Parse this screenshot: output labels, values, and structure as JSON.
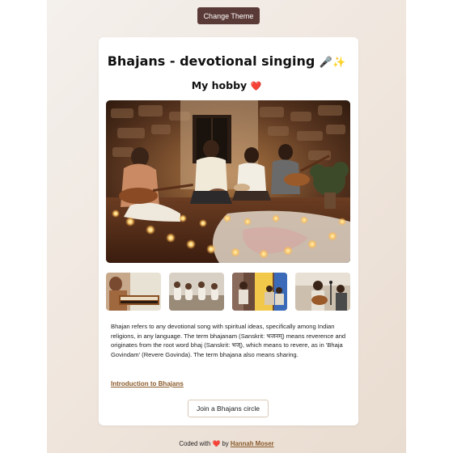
{
  "toolbar": {
    "theme_button_label": "Change Theme"
  },
  "header": {
    "title": "Bhajans - devotional singing",
    "title_icons": "🎤✨",
    "subtitle": "My hobby",
    "subtitle_icon": "❤️"
  },
  "gallery": {
    "hero_alt": "Group singing bhajans in candlelit room",
    "thumbnails": [
      {
        "alt": "Harmonium player"
      },
      {
        "alt": "Group sitting in circle"
      },
      {
        "alt": "Singers with colorful light"
      },
      {
        "alt": "Guitar and microphone singer"
      }
    ]
  },
  "content": {
    "paragraph": "Bhajan refers to any devotional song with spiritual ideas, specifically among Indian religions, in any language. The term bhajanam (Sanskrit: भजनम्) means reverence and originates from the root word bhaj (Sanskrit: भज्), which means to revere, as in 'Bhaja Govindam' (Revere Govinda). The term bhajana also means sharing.",
    "intro_link": "Introduction to Bhajans",
    "join_button": "Join a Bhajans circle"
  },
  "footer": {
    "prefix": "Coded with",
    "heart": "❤️",
    "by": "by",
    "author": "Hannah Moser"
  },
  "colors": {
    "theme_button_bg": "#5a3a36",
    "link": "#8a5a2a",
    "heart": "#e0244a"
  }
}
